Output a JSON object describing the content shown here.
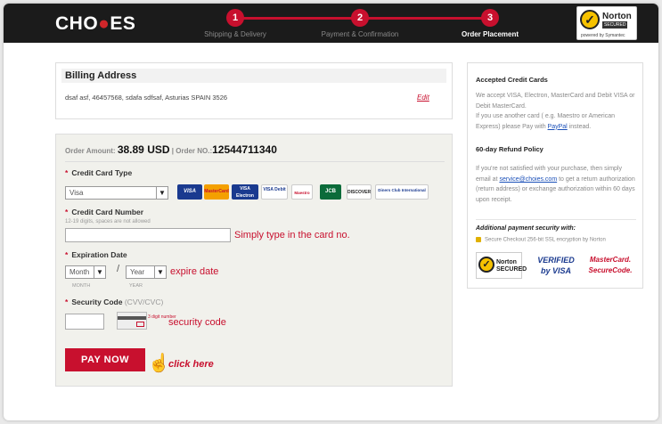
{
  "header": {
    "logo_text_a": "CHO",
    "logo_text_b": "ES",
    "steps": [
      {
        "number": "1",
        "label": "Shipping & Delivery",
        "active": false
      },
      {
        "number": "2",
        "label": "Payment & Confirmation",
        "active": false
      },
      {
        "number": "3",
        "label": "Order Placement",
        "active": true
      }
    ],
    "norton": {
      "name": "Norton",
      "secured": "SECURED",
      "powered": "powered by Symantec"
    }
  },
  "billing": {
    "title": "Billing Address",
    "address": "dsaf asf, 46457568, sdafa sdfsaf, Asturias SPAIN 3526",
    "edit_label": "Edit"
  },
  "payment": {
    "amount_label": "Order Amount:",
    "amount_value": "38.89 USD",
    "order_no_label": "| Order NO.:",
    "order_no_value": "12544711340",
    "card_type_label": "Credit Card Type",
    "card_type_value": "Visa",
    "card_logos": [
      "VISA",
      "MasterCard",
      "VISA Electron",
      "VISA Debit",
      "Maestro",
      "JCB",
      "DISCOVER",
      "Diners Club International"
    ],
    "card_number_label": "Credit Card Number",
    "card_number_hint": "12-19 digits, spaces are not allowed",
    "card_number_value": "",
    "card_number_note": "Simply type in the card no.",
    "expiration_label": "Expiration Date",
    "month_value": "Month",
    "month_caption": "MONTH",
    "year_value": "Year",
    "year_caption": "YEAR",
    "slash": "/",
    "expiration_note": "expire date",
    "security_label": "Security Code",
    "security_sub": "(CVV/CVC)",
    "security_value": "",
    "security_tip": "3 digit number",
    "security_note": "security code",
    "pay_button": "PAY NOW",
    "click_note": "click here"
  },
  "sidebar": {
    "accepted_title": "Accepted Credit Cards",
    "accepted_text_a": "We accept VISA, Electron, MasterCard and Debit VISA or Debit MasterCard.",
    "accepted_text_b": "If you use another card ( e.g. Maestro or American Express) please Pay with",
    "paypal_link": "PayPal",
    "accepted_text_c": "instead.",
    "refund_title": "60-day Refund Policy",
    "refund_text_a": "If you're not satisfied with your purchase, then simply email at",
    "refund_email": "service@choies.com",
    "refund_text_b": "to get a return authorization (return address) or exchange authorization within 60 days upon receipt.",
    "security_title": "Additional payment security with:",
    "ssl_text": "Secure Checkout 256-bit SSL encryption by Norton",
    "seals": [
      "Norton SECURED",
      "VERIFIED by VISA",
      "MasterCard. SecureCode."
    ]
  },
  "colors": {
    "accent": "#c8102e",
    "header_bg": "#1b1b1b",
    "form_bg": "#f1f1ec",
    "link": "#1a4fb8"
  }
}
